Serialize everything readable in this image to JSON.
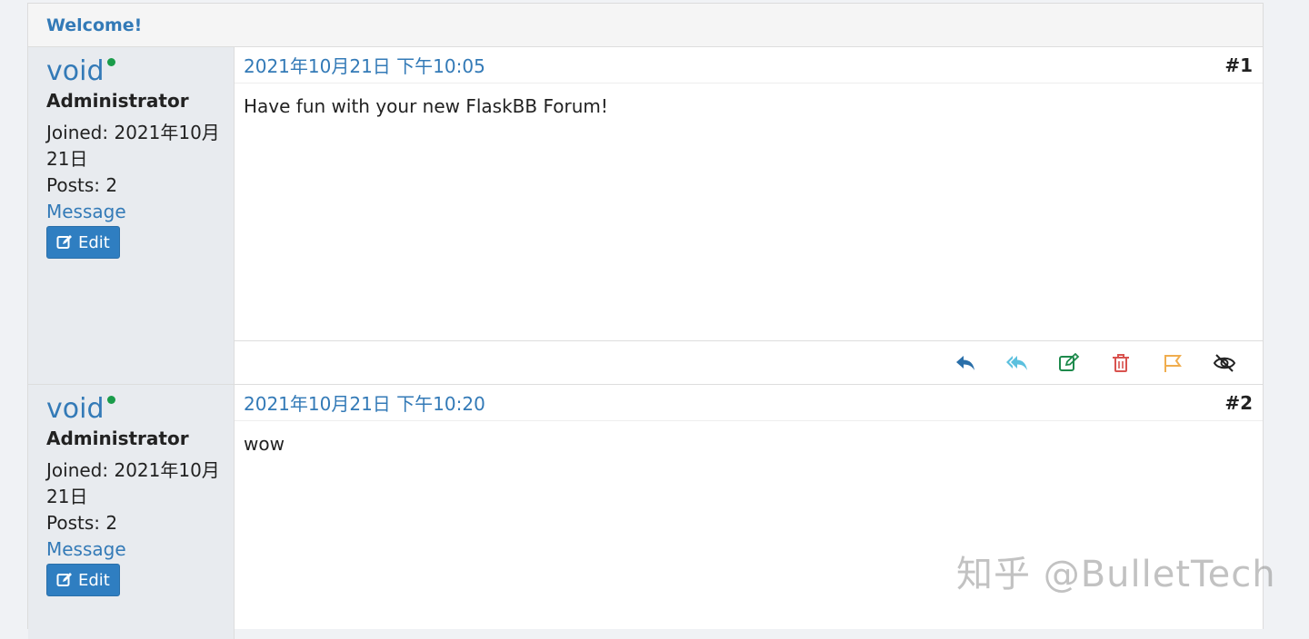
{
  "panel": {
    "heading": "Welcome!"
  },
  "posts": [
    {
      "author": {
        "name": "void",
        "role": "Administrator",
        "joined_line1": "Joined: 2021年10月",
        "joined_line2": "21日",
        "posts": "Posts: 2",
        "message_label": "Message",
        "edit_label": "Edit"
      },
      "date": "2021年10月21日 下午10:05",
      "number": "#1",
      "content": "Have fun with your new FlaskBB Forum!"
    },
    {
      "author": {
        "name": "void",
        "role": "Administrator",
        "joined_line1": "Joined: 2021年10月",
        "joined_line2": "21日",
        "posts": "Posts: 2",
        "message_label": "Message",
        "edit_label": "Edit"
      },
      "date": "2021年10月21日 下午10:20",
      "number": "#2",
      "content": "wow"
    }
  ],
  "actions": [
    {
      "name": "reply-icon",
      "color": "#2a6fa9"
    },
    {
      "name": "quote-reply-icon",
      "color": "#5bc0de"
    },
    {
      "name": "edit-icon",
      "color": "#1e8a4c"
    },
    {
      "name": "delete-icon",
      "color": "#d9534f"
    },
    {
      "name": "report-flag-icon",
      "color": "#f0ad4e"
    },
    {
      "name": "hide-icon",
      "color": "#222222"
    }
  ],
  "colors": {
    "accent": "#337ab7",
    "online": "#1a9c4a",
    "button": "#2f7ec1"
  },
  "watermark": "知乎 @BulletTech"
}
